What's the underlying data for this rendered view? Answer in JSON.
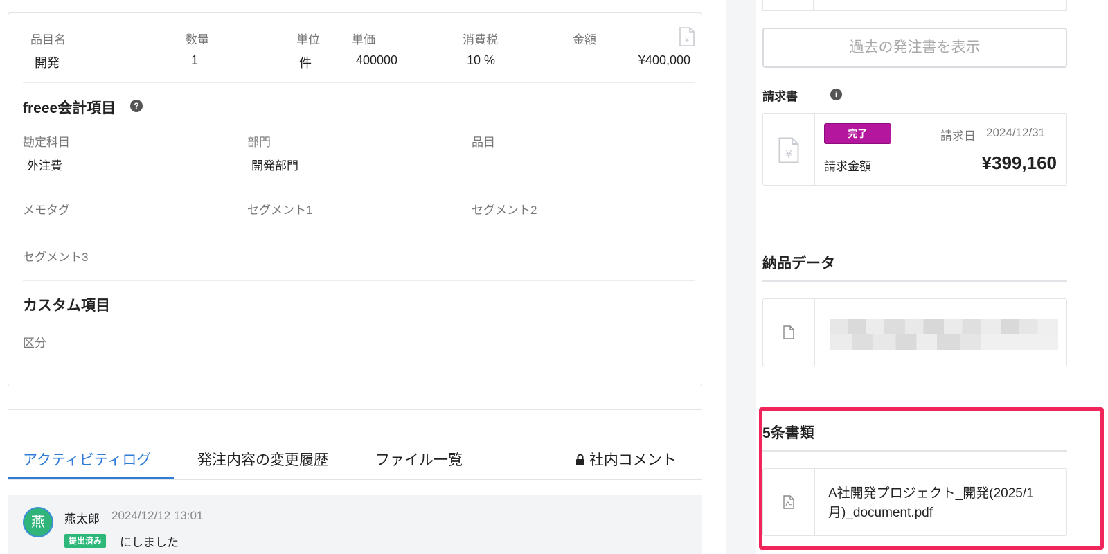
{
  "items": {
    "headers": {
      "name": "品目名",
      "qty": "数量",
      "unit": "単位",
      "price": "単価",
      "tax": "消費税",
      "amount": "金額"
    },
    "row": {
      "name": "開発",
      "qty": "1",
      "unit": "件",
      "price": "400000",
      "tax": "10 %",
      "amount": "¥400,000"
    }
  },
  "freee": {
    "title": "freee会計項目",
    "fields": [
      {
        "label": "勘定科目",
        "value": "外注費"
      },
      {
        "label": "部門",
        "value": "開発部門"
      },
      {
        "label": "品目",
        "value": ""
      },
      {
        "label": "メモタグ",
        "value": ""
      },
      {
        "label": "セグメント1",
        "value": ""
      },
      {
        "label": "セグメント2",
        "value": ""
      },
      {
        "label": "セグメント3",
        "value": ""
      }
    ]
  },
  "custom": {
    "title": "カスタム項目",
    "fields": [
      {
        "label": "区分",
        "value": ""
      }
    ]
  },
  "tabs": [
    "アクティビティログ",
    "発注内容の変更履歴",
    "ファイル一覧",
    "社内コメント"
  ],
  "activity": {
    "avatar": "燕",
    "user": "燕太郎",
    "time": "2024/12/12 13:01",
    "badge": "提出済み",
    "text": "にしました"
  },
  "sidebar": {
    "past_button": "過去の発注書を表示",
    "invoice": {
      "label": "請求書",
      "status": "完了",
      "date_label": "請求日",
      "date": "2024/12/31",
      "amount_label": "請求金額",
      "amount": "¥399,160"
    },
    "delivery": {
      "title": "納品データ"
    },
    "article5": {
      "title": "5条書類",
      "file_name": "A社開発プロジェクト_開発(2025/1月)_document.pdf"
    }
  },
  "colors": {
    "accent": "#2f7bd8",
    "done_badge": "#b5169e",
    "submitted_badge": "#2db87a",
    "highlight": "#f0265a"
  }
}
